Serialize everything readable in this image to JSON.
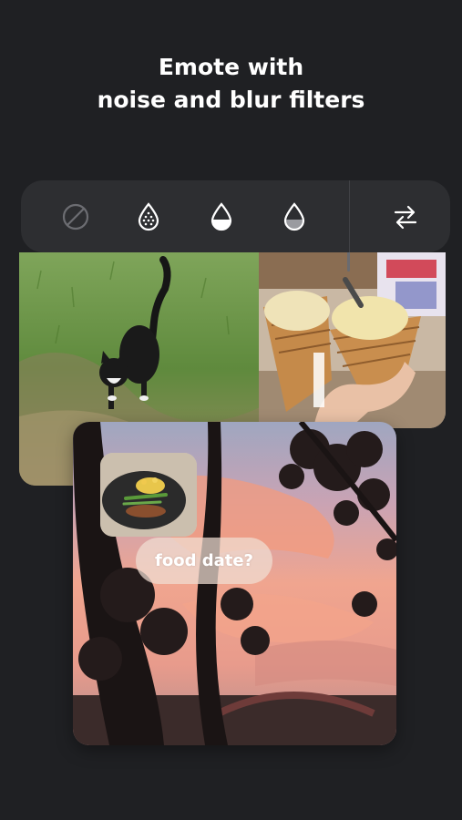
{
  "headline": {
    "line1": "Emote with",
    "line2": "noise and blur filters"
  },
  "toolbar": {
    "tools": [
      {
        "icon": "no-filter-icon"
      },
      {
        "icon": "noise-drop-icon"
      },
      {
        "icon": "blur-half-drop-icon"
      },
      {
        "icon": "blur-light-drop-icon"
      }
    ],
    "swap_icon": "swap-arrows-icon"
  },
  "photos": [
    {
      "subject": "cat"
    },
    {
      "subject": "ice-cream"
    },
    {
      "subject": "sunset"
    }
  ],
  "sticker": {
    "bubble_text": "food date?"
  },
  "colors": {
    "background": "#1f2023",
    "toolbar": "#2d2e31",
    "text": "#ffffff"
  }
}
